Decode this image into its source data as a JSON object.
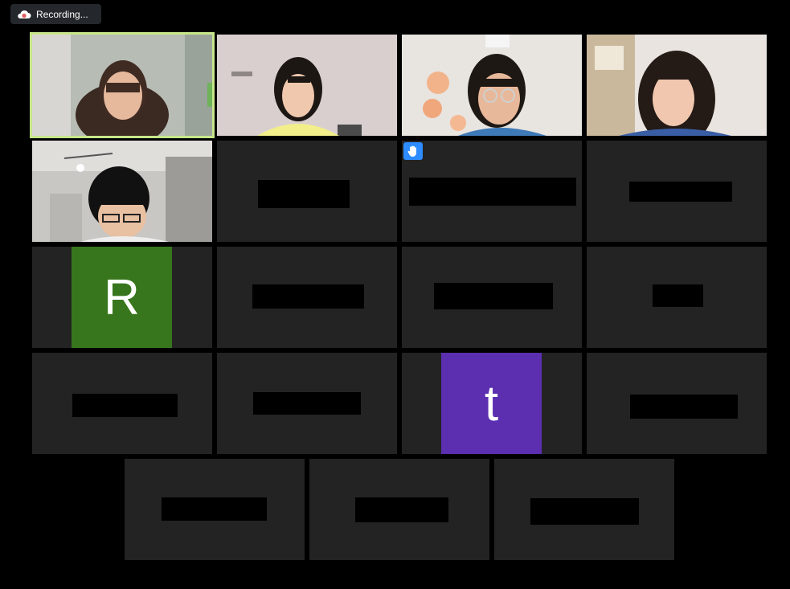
{
  "recording": {
    "label": "Recording...",
    "icon": "cloud-recording-icon",
    "icon_color": "#e25d5d"
  },
  "participants": [
    {
      "id": 1,
      "type": "video",
      "active_speaker": true,
      "description": "video-feed"
    },
    {
      "id": 2,
      "type": "video",
      "active_speaker": false
    },
    {
      "id": 3,
      "type": "video",
      "active_speaker": false
    },
    {
      "id": 4,
      "type": "video",
      "active_speaker": false
    },
    {
      "id": 5,
      "type": "video",
      "active_speaker": false
    },
    {
      "id": 6,
      "type": "name-redacted"
    },
    {
      "id": 7,
      "type": "name-redacted",
      "hand_raised": true
    },
    {
      "id": 8,
      "type": "name-redacted"
    },
    {
      "id": 9,
      "type": "avatar",
      "initial": "R",
      "color": "#38761d"
    },
    {
      "id": 10,
      "type": "name-redacted"
    },
    {
      "id": 11,
      "type": "name-redacted"
    },
    {
      "id": 12,
      "type": "name-redacted"
    },
    {
      "id": 13,
      "type": "name-redacted"
    },
    {
      "id": 14,
      "type": "name-redacted"
    },
    {
      "id": 15,
      "type": "avatar",
      "initial": "t",
      "color": "#5b2fb0"
    },
    {
      "id": 16,
      "type": "name-redacted"
    },
    {
      "id": 17,
      "type": "name-redacted"
    },
    {
      "id": 18,
      "type": "name-redacted"
    },
    {
      "id": 19,
      "type": "name-redacted"
    }
  ],
  "colors": {
    "background": "#000000",
    "tile": "#232323",
    "active_speaker_border": "#c6e68a",
    "raise_hand": "#2d8cff"
  }
}
